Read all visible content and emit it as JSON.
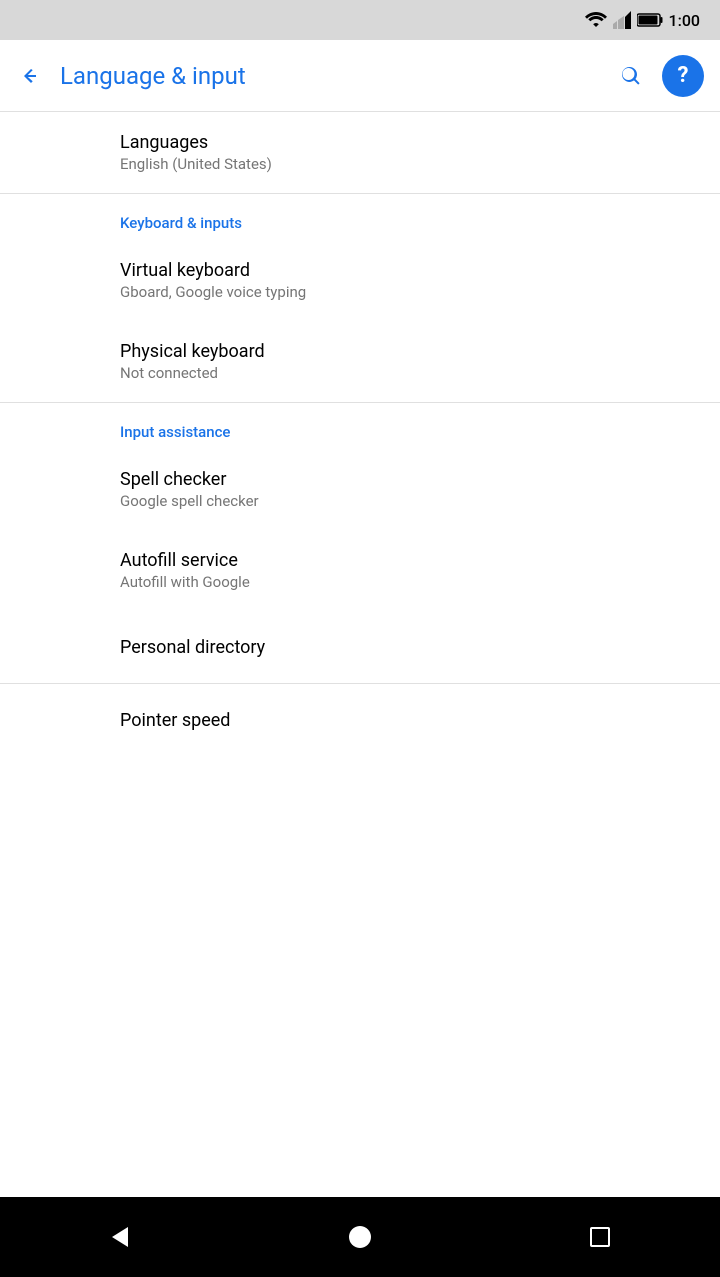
{
  "statusBar": {
    "time": "1:00"
  },
  "appBar": {
    "backLabel": "←",
    "title": "Language & input",
    "searchAriaLabel": "search",
    "helpAriaLabel": "help"
  },
  "sections": [
    {
      "items": [
        {
          "title": "Languages",
          "subtitle": "English (United States)"
        }
      ]
    },
    {
      "header": "Keyboard & inputs",
      "items": [
        {
          "title": "Virtual keyboard",
          "subtitle": "Gboard, Google voice typing"
        },
        {
          "title": "Physical keyboard",
          "subtitle": "Not connected"
        }
      ]
    },
    {
      "header": "Input assistance",
      "items": [
        {
          "title": "Spell checker",
          "subtitle": "Google spell checker"
        },
        {
          "title": "Autofill service",
          "subtitle": "Autofill with Google"
        },
        {
          "title": "Personal directory",
          "subtitle": ""
        }
      ]
    },
    {
      "items": [
        {
          "title": "Pointer speed",
          "subtitle": ""
        }
      ]
    }
  ],
  "navBar": {
    "backLabel": "◀",
    "homeLabel": "●",
    "recentLabel": "■"
  }
}
